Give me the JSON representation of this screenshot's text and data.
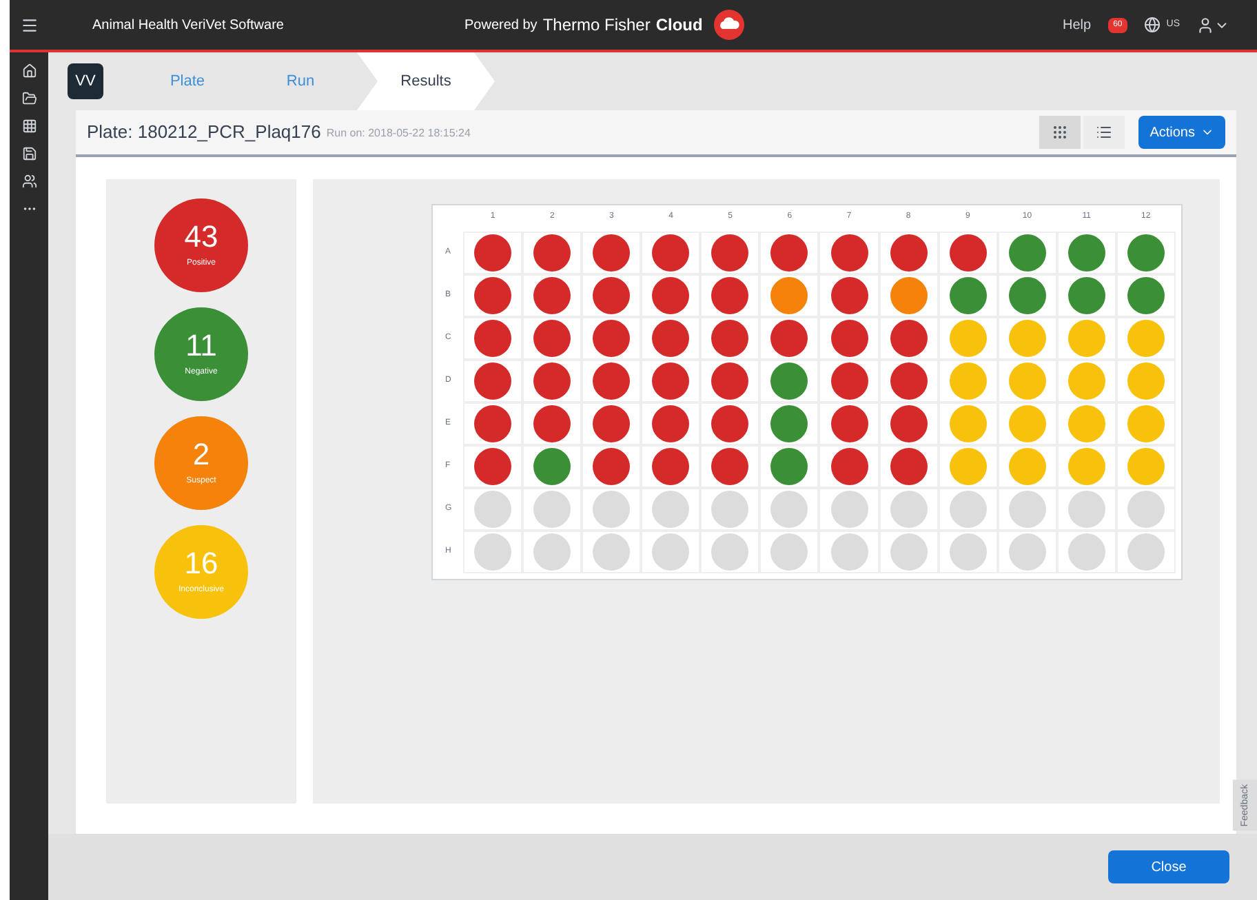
{
  "app_title": "Animal Health VeriVet Software",
  "powered": {
    "prefix": "Powered by",
    "brand": "Thermo Fisher",
    "cloud": "Cloud"
  },
  "top_right": {
    "help": "Help",
    "badge": "60",
    "region": "US"
  },
  "steps": [
    {
      "label": "Plate",
      "selected": false
    },
    {
      "label": "Run",
      "selected": false
    },
    {
      "label": "Results",
      "selected": true
    }
  ],
  "logo": "VV",
  "plate": {
    "name": "Plate: 180212_PCR_Plaq176",
    "run_on": "Run on: 2018-05-22 18:15:24"
  },
  "views": [
    {
      "kind": "grid",
      "selected": true
    },
    {
      "kind": "list",
      "selected": false
    }
  ],
  "actions": "Actions",
  "summary": [
    {
      "count": "43",
      "label": "Positive",
      "kind": "positive"
    },
    {
      "count": "11",
      "label": "Negative",
      "kind": "negative"
    },
    {
      "count": "2",
      "label": "Suspect",
      "kind": "suspect"
    },
    {
      "count": "16",
      "label": "Inconclusive",
      "kind": "inconclusive"
    }
  ],
  "columns": [
    "1",
    "2",
    "3",
    "4",
    "5",
    "6",
    "7",
    "8",
    "9",
    "10",
    "11",
    "12"
  ],
  "rows": [
    {
      "label": "A",
      "wells": [
        {
          "kind": "positive"
        },
        {
          "kind": "positive"
        },
        {
          "kind": "positive"
        },
        {
          "kind": "positive"
        },
        {
          "kind": "positive"
        },
        {
          "kind": "positive"
        },
        {
          "kind": "positive"
        },
        {
          "kind": "positive"
        },
        {
          "kind": "positive"
        },
        {
          "kind": "negative"
        },
        {
          "kind": "negative"
        },
        {
          "kind": "negative"
        }
      ]
    },
    {
      "label": "B",
      "wells": [
        {
          "kind": "positive"
        },
        {
          "kind": "positive"
        },
        {
          "kind": "positive"
        },
        {
          "kind": "positive"
        },
        {
          "kind": "positive"
        },
        {
          "kind": "suspect"
        },
        {
          "kind": "positive"
        },
        {
          "kind": "suspect"
        },
        {
          "kind": "negative"
        },
        {
          "kind": "negative"
        },
        {
          "kind": "negative"
        },
        {
          "kind": "negative"
        }
      ]
    },
    {
      "label": "C",
      "wells": [
        {
          "kind": "positive"
        },
        {
          "kind": "positive"
        },
        {
          "kind": "positive"
        },
        {
          "kind": "positive"
        },
        {
          "kind": "positive"
        },
        {
          "kind": "positive"
        },
        {
          "kind": "positive"
        },
        {
          "kind": "positive"
        },
        {
          "kind": "inconclusive"
        },
        {
          "kind": "inconclusive"
        },
        {
          "kind": "inconclusive"
        },
        {
          "kind": "inconclusive"
        }
      ]
    },
    {
      "label": "D",
      "wells": [
        {
          "kind": "positive"
        },
        {
          "kind": "positive"
        },
        {
          "kind": "positive"
        },
        {
          "kind": "positive"
        },
        {
          "kind": "positive"
        },
        {
          "kind": "negative"
        },
        {
          "kind": "positive"
        },
        {
          "kind": "positive"
        },
        {
          "kind": "inconclusive"
        },
        {
          "kind": "inconclusive"
        },
        {
          "kind": "inconclusive"
        },
        {
          "kind": "inconclusive"
        }
      ]
    },
    {
      "label": "E",
      "wells": [
        {
          "kind": "positive"
        },
        {
          "kind": "positive"
        },
        {
          "kind": "positive"
        },
        {
          "kind": "positive"
        },
        {
          "kind": "positive"
        },
        {
          "kind": "negative"
        },
        {
          "kind": "positive"
        },
        {
          "kind": "positive"
        },
        {
          "kind": "inconclusive"
        },
        {
          "kind": "inconclusive"
        },
        {
          "kind": "inconclusive"
        },
        {
          "kind": "inconclusive"
        }
      ]
    },
    {
      "label": "F",
      "wells": [
        {
          "kind": "positive"
        },
        {
          "kind": "negative"
        },
        {
          "kind": "positive"
        },
        {
          "kind": "positive"
        },
        {
          "kind": "positive"
        },
        {
          "kind": "negative"
        },
        {
          "kind": "positive"
        },
        {
          "kind": "positive"
        },
        {
          "kind": "inconclusive"
        },
        {
          "kind": "inconclusive"
        },
        {
          "kind": "inconclusive"
        },
        {
          "kind": "inconclusive"
        }
      ]
    },
    {
      "label": "G",
      "wells": [
        {
          "kind": "empty"
        },
        {
          "kind": "empty"
        },
        {
          "kind": "empty"
        },
        {
          "kind": "empty"
        },
        {
          "kind": "empty"
        },
        {
          "kind": "empty"
        },
        {
          "kind": "empty"
        },
        {
          "kind": "empty"
        },
        {
          "kind": "empty"
        },
        {
          "kind": "empty"
        },
        {
          "kind": "empty"
        },
        {
          "kind": "empty"
        }
      ]
    },
    {
      "label": "H",
      "wells": [
        {
          "kind": "empty"
        },
        {
          "kind": "empty"
        },
        {
          "kind": "empty"
        },
        {
          "kind": "empty"
        },
        {
          "kind": "empty"
        },
        {
          "kind": "empty"
        },
        {
          "kind": "empty"
        },
        {
          "kind": "empty"
        },
        {
          "kind": "empty"
        },
        {
          "kind": "empty"
        },
        {
          "kind": "empty"
        },
        {
          "kind": "empty"
        }
      ]
    }
  ],
  "feedback": "Feedback",
  "close": "Close"
}
